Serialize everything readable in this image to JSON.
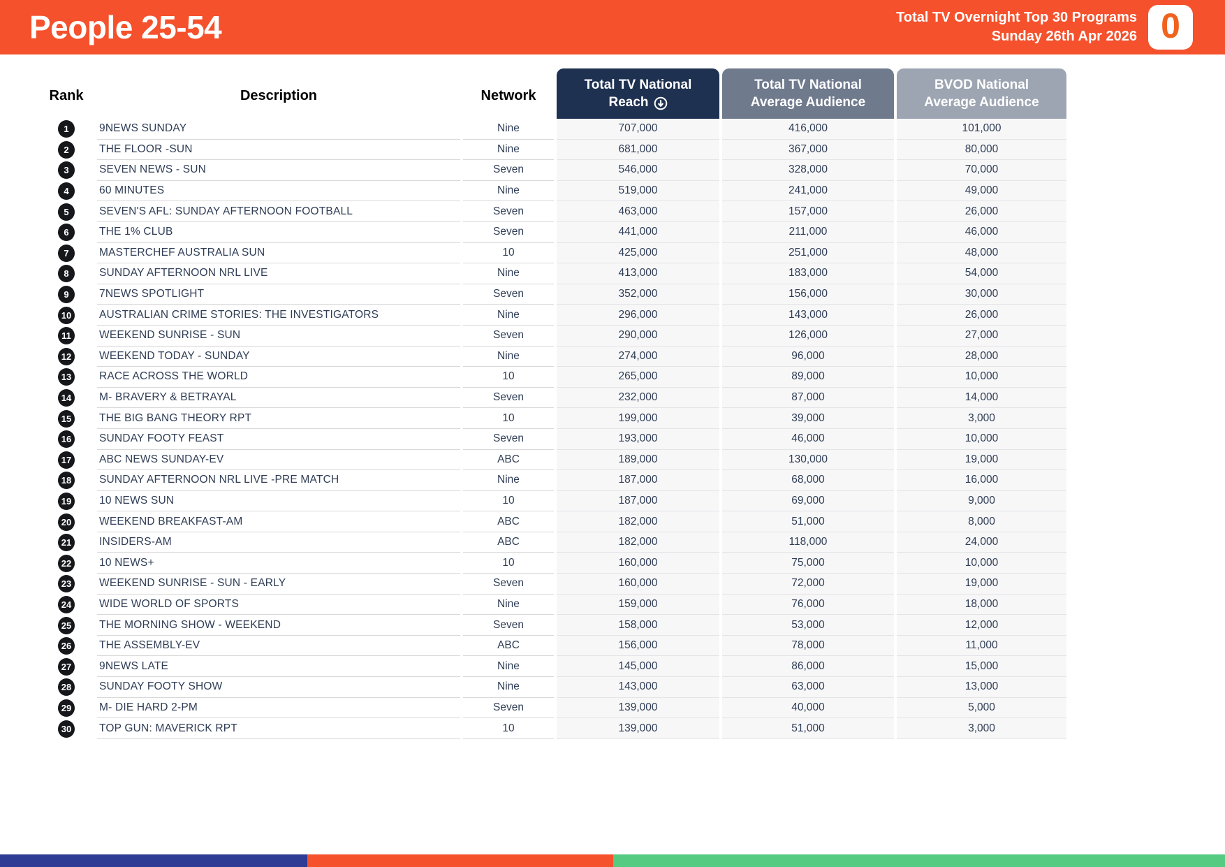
{
  "banner": {
    "title": "People 25-54",
    "subtitle_line1": "Total TV Overnight Top 30 Programs",
    "subtitle_line2": "Sunday 26th Apr 2026",
    "logo_glyph": "0",
    "bg_color": "#F4512C"
  },
  "table": {
    "rank_header": "Rank",
    "description_header": "Description",
    "network_header": "Network",
    "reach_header": {
      "line1": "Total TV National",
      "line2": "Reach"
    },
    "avg_header": {
      "line1": "Total TV National",
      "line2": "Average Audience"
    },
    "bvod_header": {
      "line1": "BVOD National",
      "line2": "Average Audience"
    },
    "header_colors": {
      "reach": "#1E3151",
      "avg": "#6F7A8D",
      "bvod": "#9DA5B2"
    },
    "sort_icon": "circle-arrow-down",
    "rows": [
      {
        "rank": "1",
        "description": "9NEWS SUNDAY",
        "network": "Nine",
        "reach": "707,000",
        "avg": "416,000",
        "bvod": "101,000"
      },
      {
        "rank": "2",
        "description": "THE FLOOR -SUN",
        "network": "Nine",
        "reach": "681,000",
        "avg": "367,000",
        "bvod": "80,000"
      },
      {
        "rank": "3",
        "description": "SEVEN NEWS - SUN",
        "network": "Seven",
        "reach": "546,000",
        "avg": "328,000",
        "bvod": "70,000"
      },
      {
        "rank": "4",
        "description": "60 MINUTES",
        "network": "Nine",
        "reach": "519,000",
        "avg": "241,000",
        "bvod": "49,000"
      },
      {
        "rank": "5",
        "description": "SEVEN'S AFL: SUNDAY AFTERNOON FOOTBALL",
        "network": "Seven",
        "reach": "463,000",
        "avg": "157,000",
        "bvod": "26,000"
      },
      {
        "rank": "6",
        "description": "THE 1% CLUB",
        "network": "Seven",
        "reach": "441,000",
        "avg": "211,000",
        "bvod": "46,000"
      },
      {
        "rank": "7",
        "description": "MASTERCHEF AUSTRALIA SUN",
        "network": "10",
        "reach": "425,000",
        "avg": "251,000",
        "bvod": "48,000"
      },
      {
        "rank": "8",
        "description": "SUNDAY AFTERNOON NRL LIVE",
        "network": "Nine",
        "reach": "413,000",
        "avg": "183,000",
        "bvod": "54,000"
      },
      {
        "rank": "9",
        "description": "7NEWS SPOTLIGHT",
        "network": "Seven",
        "reach": "352,000",
        "avg": "156,000",
        "bvod": "30,000"
      },
      {
        "rank": "10",
        "description": "AUSTRALIAN CRIME STORIES: THE INVESTIGATORS",
        "network": "Nine",
        "reach": "296,000",
        "avg": "143,000",
        "bvod": "26,000"
      },
      {
        "rank": "11",
        "description": "WEEKEND SUNRISE - SUN",
        "network": "Seven",
        "reach": "290,000",
        "avg": "126,000",
        "bvod": "27,000"
      },
      {
        "rank": "12",
        "description": "WEEKEND TODAY - SUNDAY",
        "network": "Nine",
        "reach": "274,000",
        "avg": "96,000",
        "bvod": "28,000"
      },
      {
        "rank": "13",
        "description": "RACE ACROSS THE WORLD",
        "network": "10",
        "reach": "265,000",
        "avg": "89,000",
        "bvod": "10,000"
      },
      {
        "rank": "14",
        "description": "M- BRAVERY & BETRAYAL",
        "network": "Seven",
        "reach": "232,000",
        "avg": "87,000",
        "bvod": "14,000"
      },
      {
        "rank": "15",
        "description": "THE BIG BANG THEORY RPT",
        "network": "10",
        "reach": "199,000",
        "avg": "39,000",
        "bvod": "3,000"
      },
      {
        "rank": "16",
        "description": "SUNDAY FOOTY FEAST",
        "network": "Seven",
        "reach": "193,000",
        "avg": "46,000",
        "bvod": "10,000"
      },
      {
        "rank": "17",
        "description": "ABC NEWS SUNDAY-EV",
        "network": "ABC",
        "reach": "189,000",
        "avg": "130,000",
        "bvod": "19,000"
      },
      {
        "rank": "18",
        "description": "SUNDAY AFTERNOON NRL LIVE -PRE MATCH",
        "network": "Nine",
        "reach": "187,000",
        "avg": "68,000",
        "bvod": "16,000"
      },
      {
        "rank": "19",
        "description": "10 NEWS SUN",
        "network": "10",
        "reach": "187,000",
        "avg": "69,000",
        "bvod": "9,000"
      },
      {
        "rank": "20",
        "description": "WEEKEND BREAKFAST-AM",
        "network": "ABC",
        "reach": "182,000",
        "avg": "51,000",
        "bvod": "8,000"
      },
      {
        "rank": "21",
        "description": "INSIDERS-AM",
        "network": "ABC",
        "reach": "182,000",
        "avg": "118,000",
        "bvod": "24,000"
      },
      {
        "rank": "22",
        "description": "10 NEWS+",
        "network": "10",
        "reach": "160,000",
        "avg": "75,000",
        "bvod": "10,000"
      },
      {
        "rank": "23",
        "description": "WEEKEND SUNRISE - SUN - EARLY",
        "network": "Seven",
        "reach": "160,000",
        "avg": "72,000",
        "bvod": "19,000"
      },
      {
        "rank": "24",
        "description": "WIDE WORLD OF SPORTS",
        "network": "Nine",
        "reach": "159,000",
        "avg": "76,000",
        "bvod": "18,000"
      },
      {
        "rank": "25",
        "description": "THE MORNING SHOW - WEEKEND",
        "network": "Seven",
        "reach": "158,000",
        "avg": "53,000",
        "bvod": "12,000"
      },
      {
        "rank": "26",
        "description": "THE ASSEMBLY-EV",
        "network": "ABC",
        "reach": "156,000",
        "avg": "78,000",
        "bvod": "11,000"
      },
      {
        "rank": "27",
        "description": "9NEWS LATE",
        "network": "Nine",
        "reach": "145,000",
        "avg": "86,000",
        "bvod": "15,000"
      },
      {
        "rank": "28",
        "description": "SUNDAY FOOTY SHOW",
        "network": "Nine",
        "reach": "143,000",
        "avg": "63,000",
        "bvod": "13,000"
      },
      {
        "rank": "29",
        "description": "M- DIE HARD 2-PM",
        "network": "Seven",
        "reach": "139,000",
        "avg": "40,000",
        "bvod": "5,000"
      },
      {
        "rank": "30",
        "description": "TOP GUN: MAVERICK RPT",
        "network": "10",
        "reach": "139,000",
        "avg": "51,000",
        "bvod": "3,000"
      }
    ]
  },
  "footer": {
    "colors": [
      "#2E3C94",
      "#F4512C",
      "#55CB82"
    ]
  }
}
